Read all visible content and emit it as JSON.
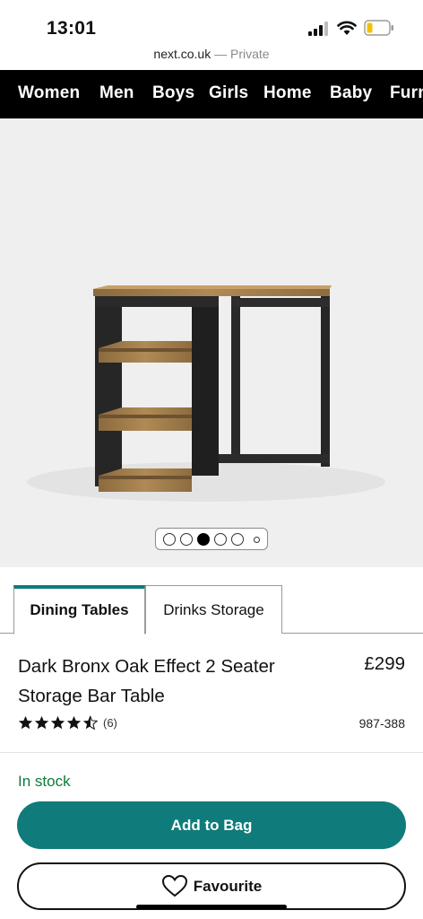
{
  "status_bar": {
    "time": "13:01",
    "battery_color": "#f2c200"
  },
  "browser": {
    "domain": "next.co.uk",
    "mode": " — Private"
  },
  "nav": {
    "items": [
      "Women",
      "Men",
      "Boys",
      "Girls",
      "Home",
      "Baby",
      "Furn"
    ]
  },
  "carousel": {
    "count": 6,
    "active_index": 2
  },
  "tabs": [
    {
      "label": "Dining Tables",
      "active": true
    },
    {
      "label": "Drinks Storage",
      "active": false
    }
  ],
  "product": {
    "title": "Dark Bronx Oak Effect 2 Seater Storage Bar Table",
    "price": "£299",
    "rating": 4.5,
    "review_count": "(6)",
    "code": "987-388",
    "stock_status": "In stock",
    "stock_color": "#0d7a3a"
  },
  "actions": {
    "add_to_bag": "Add to Bag",
    "favourite": "Favourite"
  },
  "colors": {
    "accent": "#0f7b7a",
    "nav_bg": "#000000"
  }
}
